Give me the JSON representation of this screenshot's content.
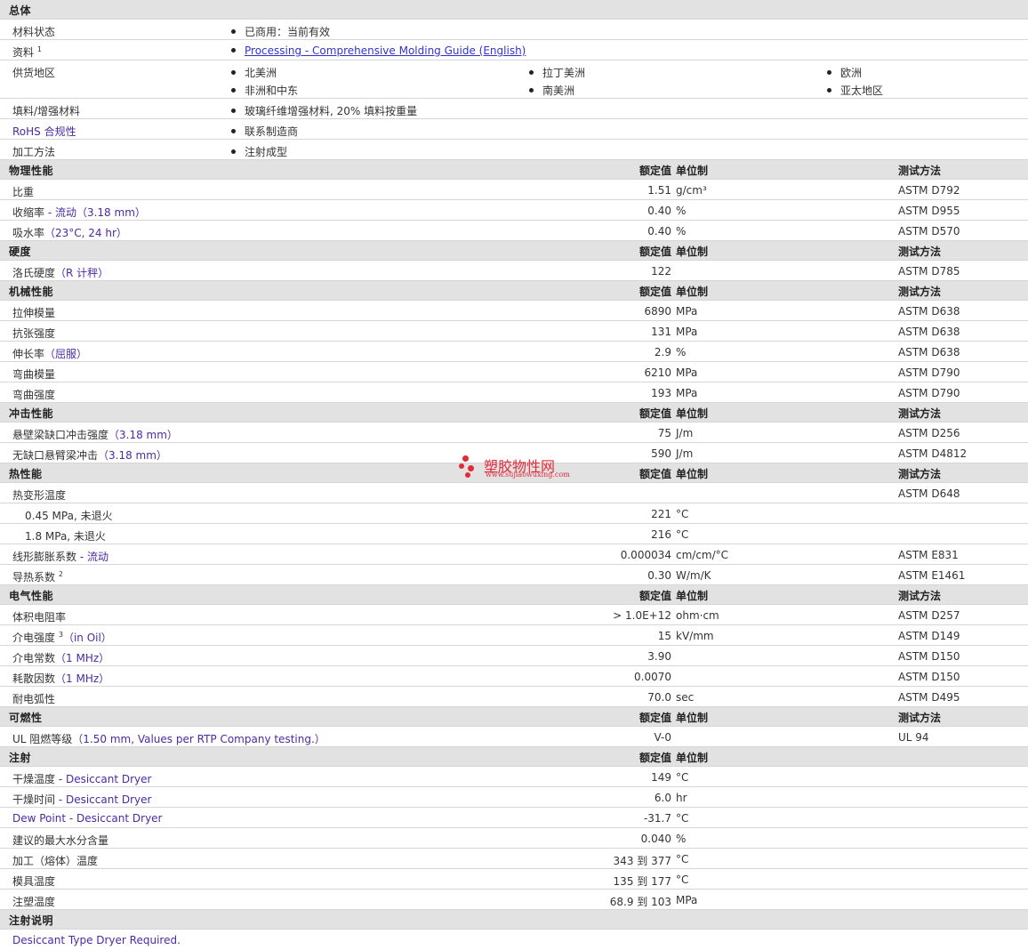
{
  "general": {
    "title": "总体",
    "rows": [
      {
        "label": "材料状态",
        "values": [
          "已商用：当前有效"
        ]
      },
      {
        "label": "资料",
        "sup": "1",
        "link": "Processing - Comprehensive Molding Guide (English)"
      },
      {
        "label": "供货地区",
        "regions": [
          [
            "北美洲",
            "拉丁美洲",
            "欧洲"
          ],
          [
            "非洲和中东",
            "南美洲",
            "亚太地区"
          ]
        ]
      },
      {
        "label": "填料/增强材料",
        "values": [
          "玻璃纤维增强材料, 20% 填料按重量"
        ]
      },
      {
        "label": "RoHS 合规性",
        "values": [
          "联系制造商"
        ]
      },
      {
        "label": "加工方法",
        "values": [
          "注射成型"
        ]
      }
    ]
  },
  "headers": {
    "value": "额定值",
    "unit": "单位制",
    "method": "测试方法"
  },
  "sections": [
    {
      "title": "物理性能",
      "rows": [
        {
          "label": "比重",
          "value": "1.51",
          "unit": "g/cm³",
          "method": "ASTM D792"
        },
        {
          "label": "收缩率",
          "blue": " - 流动（3.18 mm）",
          "value": "0.40",
          "unit": "%",
          "method": "ASTM D955"
        },
        {
          "label": "吸水率",
          "blue": "（23°C, 24 hr）",
          "value": "0.40",
          "unit": "%",
          "method": "ASTM D570"
        }
      ]
    },
    {
      "title": "硬度",
      "rows": [
        {
          "label": "洛氏硬度",
          "blue": "（R 计秤）",
          "value": "122",
          "unit": "",
          "method": "ASTM D785"
        }
      ]
    },
    {
      "title": "机械性能",
      "rows": [
        {
          "label": "拉伸模量",
          "value": "6890",
          "unit": "MPa",
          "method": "ASTM D638"
        },
        {
          "label": "抗张强度",
          "value": "131",
          "unit": "MPa",
          "method": "ASTM D638"
        },
        {
          "label": "伸长率",
          "blue": "（屈服）",
          "value": "2.9",
          "unit": "%",
          "method": "ASTM D638"
        },
        {
          "label": "弯曲模量",
          "value": "6210",
          "unit": "MPa",
          "method": "ASTM D790"
        },
        {
          "label": "弯曲强度",
          "value": "193",
          "unit": "MPa",
          "method": "ASTM D790"
        }
      ]
    },
    {
      "title": "冲击性能",
      "rows": [
        {
          "label": "悬壁梁缺口冲击强度",
          "blue": "（3.18 mm）",
          "value": "75",
          "unit": "J/m",
          "method": "ASTM D256"
        },
        {
          "label": "无缺口悬臂梁冲击",
          "blue": "（3.18 mm）",
          "value": "590",
          "unit": "J/m",
          "method": "ASTM D4812"
        }
      ]
    },
    {
      "title": "热性能",
      "rows": [
        {
          "label": "热变形温度",
          "value": "",
          "unit": "",
          "method": "ASTM D648"
        },
        {
          "label": "0.45 MPa, 未退火",
          "sub": true,
          "value": "221",
          "unit": "°C",
          "method": ""
        },
        {
          "label": "1.8 MPa, 未退火",
          "sub": true,
          "value": "216",
          "unit": "°C",
          "method": ""
        },
        {
          "label": "线形膨胀系数",
          "blue": " - 流动",
          "value": "0.000034",
          "unit": "cm/cm/°C",
          "method": "ASTM E831"
        },
        {
          "label": "导热系数",
          "sup": "2",
          "value": "0.30",
          "unit": "W/m/K",
          "method": "ASTM E1461"
        }
      ]
    },
    {
      "title": "电气性能",
      "rows": [
        {
          "label": "体积电阻率",
          "value": "> 1.0E+12",
          "unit": "ohm·cm",
          "method": "ASTM D257"
        },
        {
          "label": "介电强度",
          "sup": "3",
          "blue": "（in Oil）",
          "value": "15",
          "unit": "kV/mm",
          "method": "ASTM D149"
        },
        {
          "label": "介电常数",
          "blue": "（1 MHz）",
          "value": "3.90",
          "unit": "",
          "method": "ASTM D150"
        },
        {
          "label": "耗散因数",
          "blue": "（1 MHz）",
          "value": "0.0070",
          "unit": "",
          "method": "ASTM D150"
        },
        {
          "label": "耐电弧性",
          "value": "70.0",
          "unit": "sec",
          "method": "ASTM D495"
        }
      ]
    },
    {
      "title": "可燃性",
      "rows": [
        {
          "label": "UL 阻燃等级",
          "blue": "（1.50 mm, Values per RTP Company testing.）",
          "value": "V-0",
          "unit": "",
          "method": "UL 94"
        }
      ]
    },
    {
      "title": "注射",
      "noMethod": true,
      "rows": [
        {
          "label": "干燥温度",
          "blue": " - Desiccant Dryer",
          "value": "149",
          "unit": "°C",
          "method": ""
        },
        {
          "label": "干燥时间",
          "blue": " - Desiccant Dryer",
          "value": "6.0",
          "unit": "hr",
          "method": ""
        },
        {
          "label": "",
          "blue": "Dew Point - Desiccant Dryer",
          "value": "-31.7",
          "unit": "°C",
          "method": ""
        },
        {
          "label": "建议的最大水分含量",
          "value": "0.040",
          "unit": "%",
          "method": ""
        },
        {
          "label": "加工（熔体）温度",
          "value": "343 到  377",
          "unit": "°C",
          "method": ""
        },
        {
          "label": "模具温度",
          "value": "135 到  177",
          "unit": "°C",
          "method": ""
        },
        {
          "label": "注塑温度",
          "value": "68.9 到  103",
          "unit": "MPa",
          "method": ""
        }
      ]
    }
  ],
  "notes": {
    "title": "注射说明",
    "text": "Desiccant Type Dryer Required."
  },
  "watermark": {
    "name": "塑胶物性网",
    "url": "www.sujiaowuxing.com",
    "color": "#e42a3a"
  }
}
